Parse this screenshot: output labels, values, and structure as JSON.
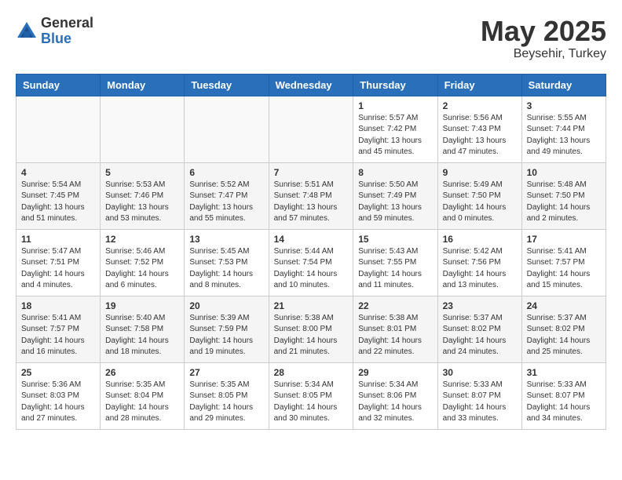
{
  "logo": {
    "general": "General",
    "blue": "Blue"
  },
  "title": {
    "month_year": "May 2025",
    "location": "Beysehir, Turkey"
  },
  "weekdays": [
    "Sunday",
    "Monday",
    "Tuesday",
    "Wednesday",
    "Thursday",
    "Friday",
    "Saturday"
  ],
  "weeks": [
    [
      {
        "day": "",
        "content": ""
      },
      {
        "day": "",
        "content": ""
      },
      {
        "day": "",
        "content": ""
      },
      {
        "day": "",
        "content": ""
      },
      {
        "day": "1",
        "content": "Sunrise: 5:57 AM\nSunset: 7:42 PM\nDaylight: 13 hours\nand 45 minutes."
      },
      {
        "day": "2",
        "content": "Sunrise: 5:56 AM\nSunset: 7:43 PM\nDaylight: 13 hours\nand 47 minutes."
      },
      {
        "day": "3",
        "content": "Sunrise: 5:55 AM\nSunset: 7:44 PM\nDaylight: 13 hours\nand 49 minutes."
      }
    ],
    [
      {
        "day": "4",
        "content": "Sunrise: 5:54 AM\nSunset: 7:45 PM\nDaylight: 13 hours\nand 51 minutes."
      },
      {
        "day": "5",
        "content": "Sunrise: 5:53 AM\nSunset: 7:46 PM\nDaylight: 13 hours\nand 53 minutes."
      },
      {
        "day": "6",
        "content": "Sunrise: 5:52 AM\nSunset: 7:47 PM\nDaylight: 13 hours\nand 55 minutes."
      },
      {
        "day": "7",
        "content": "Sunrise: 5:51 AM\nSunset: 7:48 PM\nDaylight: 13 hours\nand 57 minutes."
      },
      {
        "day": "8",
        "content": "Sunrise: 5:50 AM\nSunset: 7:49 PM\nDaylight: 13 hours\nand 59 minutes."
      },
      {
        "day": "9",
        "content": "Sunrise: 5:49 AM\nSunset: 7:50 PM\nDaylight: 14 hours\nand 0 minutes."
      },
      {
        "day": "10",
        "content": "Sunrise: 5:48 AM\nSunset: 7:50 PM\nDaylight: 14 hours\nand 2 minutes."
      }
    ],
    [
      {
        "day": "11",
        "content": "Sunrise: 5:47 AM\nSunset: 7:51 PM\nDaylight: 14 hours\nand 4 minutes."
      },
      {
        "day": "12",
        "content": "Sunrise: 5:46 AM\nSunset: 7:52 PM\nDaylight: 14 hours\nand 6 minutes."
      },
      {
        "day": "13",
        "content": "Sunrise: 5:45 AM\nSunset: 7:53 PM\nDaylight: 14 hours\nand 8 minutes."
      },
      {
        "day": "14",
        "content": "Sunrise: 5:44 AM\nSunset: 7:54 PM\nDaylight: 14 hours\nand 10 minutes."
      },
      {
        "day": "15",
        "content": "Sunrise: 5:43 AM\nSunset: 7:55 PM\nDaylight: 14 hours\nand 11 minutes."
      },
      {
        "day": "16",
        "content": "Sunrise: 5:42 AM\nSunset: 7:56 PM\nDaylight: 14 hours\nand 13 minutes."
      },
      {
        "day": "17",
        "content": "Sunrise: 5:41 AM\nSunset: 7:57 PM\nDaylight: 14 hours\nand 15 minutes."
      }
    ],
    [
      {
        "day": "18",
        "content": "Sunrise: 5:41 AM\nSunset: 7:57 PM\nDaylight: 14 hours\nand 16 minutes."
      },
      {
        "day": "19",
        "content": "Sunrise: 5:40 AM\nSunset: 7:58 PM\nDaylight: 14 hours\nand 18 minutes."
      },
      {
        "day": "20",
        "content": "Sunrise: 5:39 AM\nSunset: 7:59 PM\nDaylight: 14 hours\nand 19 minutes."
      },
      {
        "day": "21",
        "content": "Sunrise: 5:38 AM\nSunset: 8:00 PM\nDaylight: 14 hours\nand 21 minutes."
      },
      {
        "day": "22",
        "content": "Sunrise: 5:38 AM\nSunset: 8:01 PM\nDaylight: 14 hours\nand 22 minutes."
      },
      {
        "day": "23",
        "content": "Sunrise: 5:37 AM\nSunset: 8:02 PM\nDaylight: 14 hours\nand 24 minutes."
      },
      {
        "day": "24",
        "content": "Sunrise: 5:37 AM\nSunset: 8:02 PM\nDaylight: 14 hours\nand 25 minutes."
      }
    ],
    [
      {
        "day": "25",
        "content": "Sunrise: 5:36 AM\nSunset: 8:03 PM\nDaylight: 14 hours\nand 27 minutes."
      },
      {
        "day": "26",
        "content": "Sunrise: 5:35 AM\nSunset: 8:04 PM\nDaylight: 14 hours\nand 28 minutes."
      },
      {
        "day": "27",
        "content": "Sunrise: 5:35 AM\nSunset: 8:05 PM\nDaylight: 14 hours\nand 29 minutes."
      },
      {
        "day": "28",
        "content": "Sunrise: 5:34 AM\nSunset: 8:05 PM\nDaylight: 14 hours\nand 30 minutes."
      },
      {
        "day": "29",
        "content": "Sunrise: 5:34 AM\nSunset: 8:06 PM\nDaylight: 14 hours\nand 32 minutes."
      },
      {
        "day": "30",
        "content": "Sunrise: 5:33 AM\nSunset: 8:07 PM\nDaylight: 14 hours\nand 33 minutes."
      },
      {
        "day": "31",
        "content": "Sunrise: 5:33 AM\nSunset: 8:07 PM\nDaylight: 14 hours\nand 34 minutes."
      }
    ]
  ]
}
